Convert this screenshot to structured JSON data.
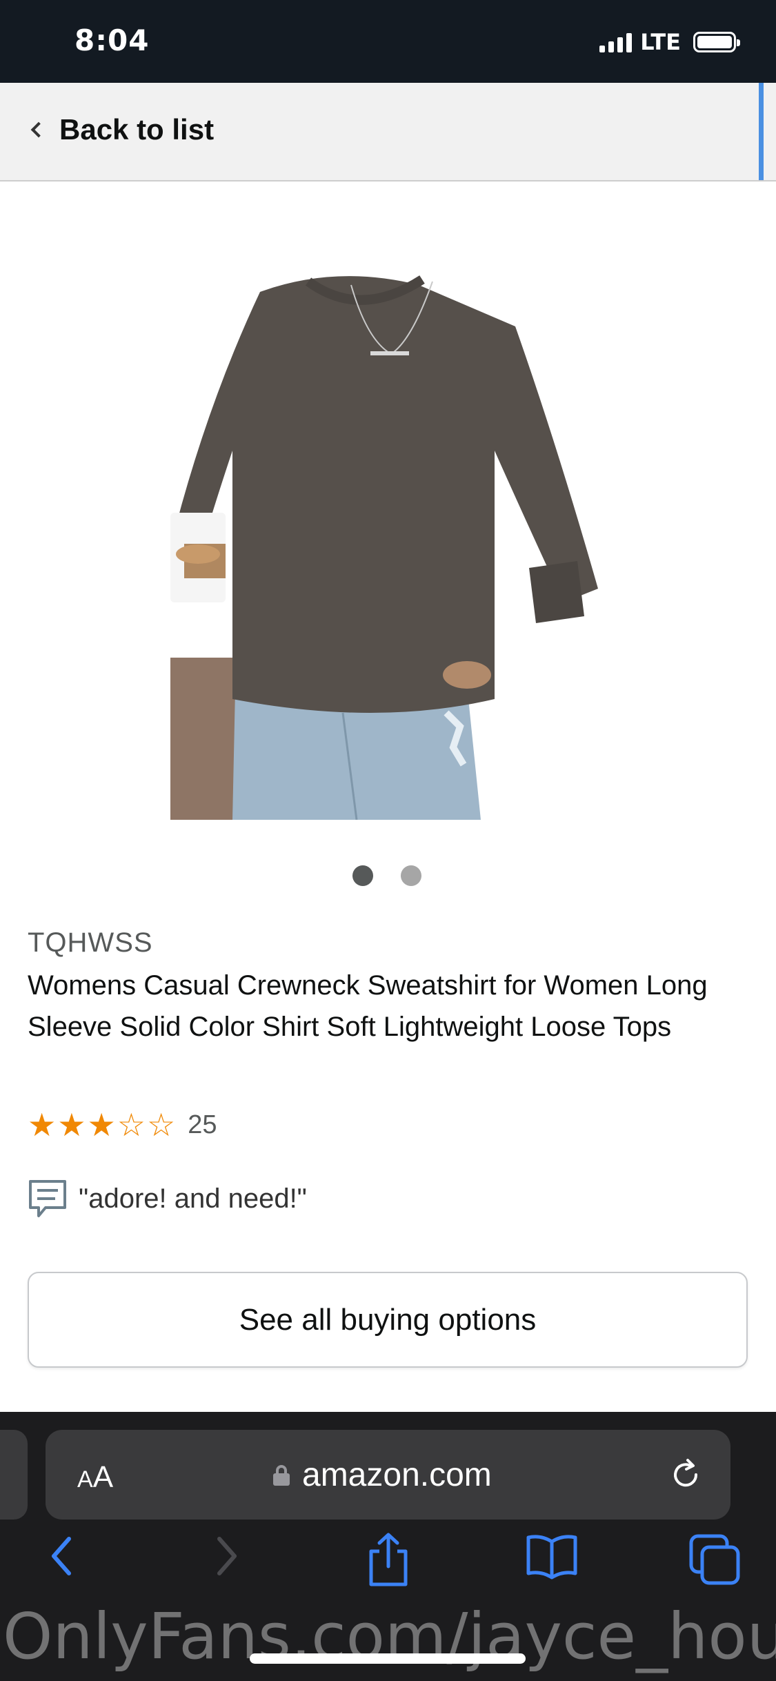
{
  "status_bar": {
    "time": "8:04",
    "network": "LTE"
  },
  "header": {
    "back_label": "Back to list",
    "accent_color": "#4a90e2"
  },
  "product": {
    "image_description_icon": "product-photo-sweatshirt",
    "carousel": {
      "total": 2,
      "active": 1
    },
    "brand": "TQHWSS",
    "title": "Womens Casual Crewneck Sweatshirt for Women Long Sleeve Solid Color Shirt Soft Lightweight Loose Tops",
    "rating": {
      "stars": 3,
      "out_of": 5,
      "count": "25",
      "star_color": "#f08804"
    },
    "review_snippet": "\"adore! and need!\"",
    "buy_button_label": "See all buying options"
  },
  "browser": {
    "text_size_label_small": "A",
    "text_size_label_large": "A",
    "url": "amazon.com",
    "toolbar": [
      "back-icon",
      "forward-icon",
      "share-icon",
      "bookmarks-icon",
      "tabs-icon"
    ]
  },
  "watermark": "OnlyFans.com/jayce_hous"
}
